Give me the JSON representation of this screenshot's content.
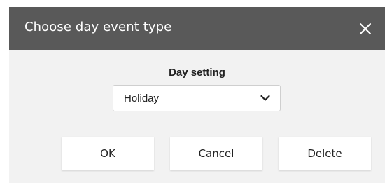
{
  "dialog": {
    "title": "Choose day event type",
    "close_icon": "close-icon",
    "field_label": "Day setting",
    "select": {
      "value": "Holiday",
      "icon": "chevron-down-icon"
    },
    "buttons": {
      "ok": "OK",
      "cancel": "Cancel",
      "delete": "Delete"
    }
  },
  "colors": {
    "titlebar": "#595959",
    "dialog_background": "#f2f2f2",
    "button_background": "#ffffff",
    "text": "#222222"
  }
}
